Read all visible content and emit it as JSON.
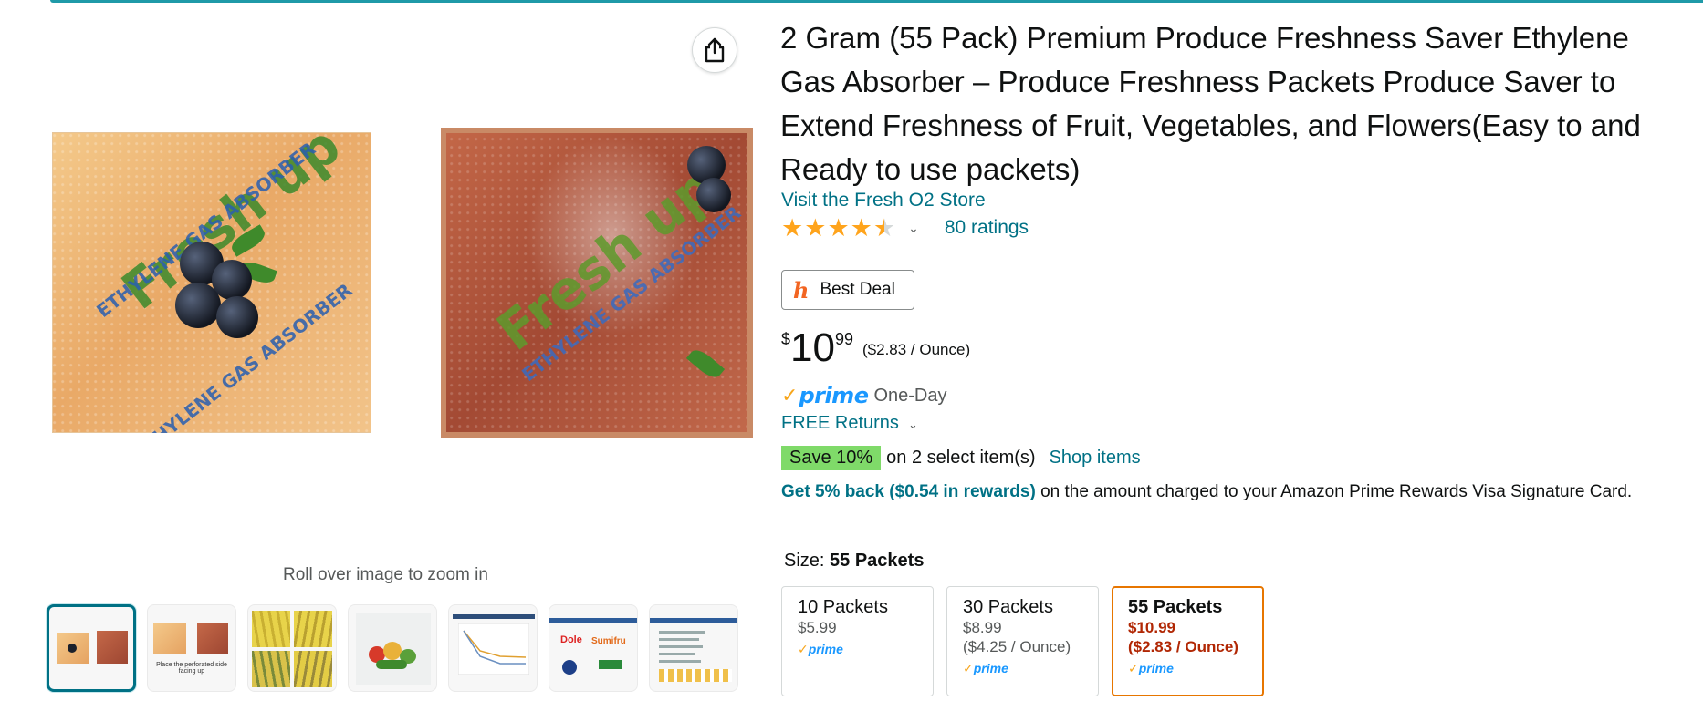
{
  "product": {
    "title": "2 Gram (55 Pack) Premium Produce Freshness Saver Ethylene Gas Absorber – Produce Freshness Packets Produce Saver to Extend Freshness of Fruit, Vegetables, and Flowers(Easy to and Ready to use packets)",
    "store_link": "Visit the Fresh O2 Store",
    "rating_stars": 4.5,
    "ratings_count": "80 ratings",
    "best_deal_label": "Best Deal",
    "price": {
      "symbol": "$",
      "whole": "10",
      "fraction": "99",
      "unit": "($2.83 / Ounce)"
    },
    "prime": {
      "word": "prime",
      "delivery": "One-Day"
    },
    "free_returns": "FREE Returns",
    "save": {
      "badge": "Save 10%",
      "text": "on 2 select item(s)",
      "link": "Shop items"
    },
    "rewards": {
      "link": "Get 5% back ($0.54 in rewards)",
      "text": " on the amount charged to your Amazon Prime Rewards Visa Signature Card."
    },
    "size": {
      "label": "Size: ",
      "selected": "55 Packets",
      "options": [
        {
          "name": "10 Packets",
          "price": "$5.99",
          "unit": "",
          "prime": "prime"
        },
        {
          "name": "30 Packets",
          "price": "$8.99",
          "unit": "($4.25 / Ounce)",
          "prime": "prime"
        },
        {
          "name": "55 Packets",
          "price": "$10.99",
          "unit": "($2.83 / Ounce)",
          "prime": "prime"
        }
      ]
    }
  },
  "gallery": {
    "zoom_hint": "Roll over image to zoom in",
    "packet_brand": "Fresh up",
    "packet_sub": "ETHYLENE GAS ABSORBER",
    "thumb_caption": "Place the perforated side facing up",
    "thumb_brands": [
      "Dole",
      "Sumifru"
    ]
  },
  "colors": {
    "link": "#007185",
    "accent_top": "#1f9aa8",
    "star": "#ffa41c",
    "save_badge": "#7fda69",
    "selected_border": "#e77600",
    "price_red": "#b12704",
    "prime_blue": "#1a98ff"
  }
}
